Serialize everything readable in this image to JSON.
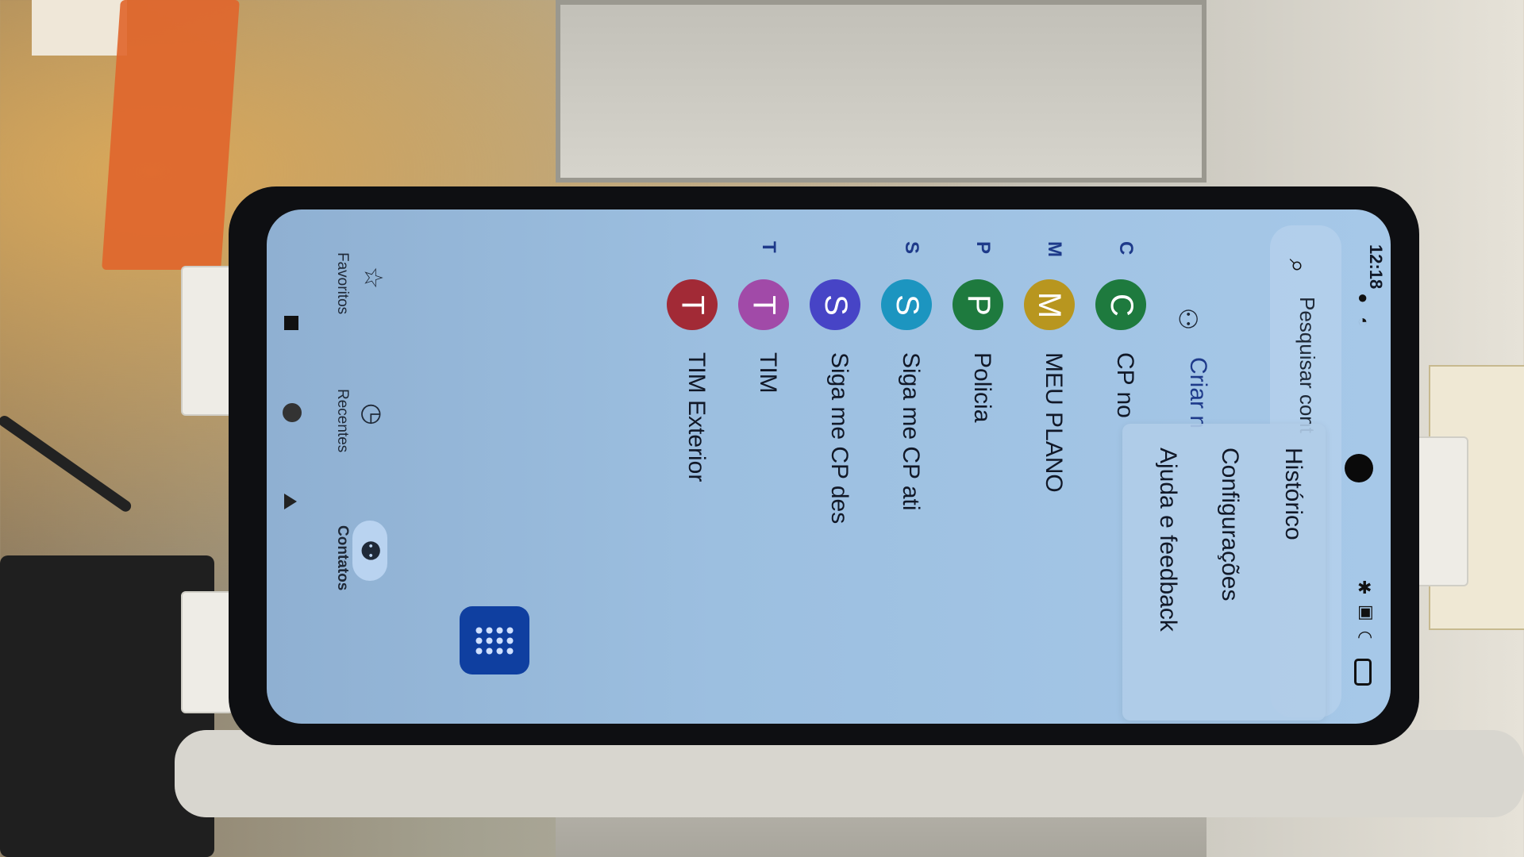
{
  "statusbar": {
    "time": "12:18",
    "icons": [
      "notification-icon",
      "alarm-icon",
      "bluetooth-icon",
      "nfc-icon",
      "wifi-icon",
      "battery-icon"
    ]
  },
  "search": {
    "placeholder": "Pesquisar cont"
  },
  "create_contact": {
    "label": "Criar n"
  },
  "overflow_menu": {
    "items": [
      {
        "label": "Histórico"
      },
      {
        "label": "Configurações"
      },
      {
        "label": "Ajuda e feedback"
      }
    ]
  },
  "contacts": {
    "groups": [
      {
        "letter": "C",
        "entries": [
          {
            "initial": "C",
            "name": "CP no",
            "color": "#1e7a3e"
          }
        ]
      },
      {
        "letter": "M",
        "entries": [
          {
            "initial": "M",
            "name": "MEU PLANO",
            "color": "#b8961f"
          }
        ]
      },
      {
        "letter": "P",
        "entries": [
          {
            "initial": "P",
            "name": "Policia",
            "color": "#1e7a3e"
          }
        ]
      },
      {
        "letter": "S",
        "entries": [
          {
            "initial": "S",
            "name": "Siga me CP ati",
            "color": "#1c95c0"
          },
          {
            "initial": "S",
            "name": "Siga me CP des",
            "color": "#4744c6"
          }
        ]
      },
      {
        "letter": "T",
        "entries": [
          {
            "initial": "T",
            "name": "TIM",
            "color": "#a14aa8"
          },
          {
            "initial": "T",
            "name": "TIM Exterior",
            "color": "#a22a36"
          }
        ]
      }
    ]
  },
  "bottom_nav": {
    "favorites": "Favoritos",
    "recents": "Recentes",
    "contacts": "Contatos"
  },
  "colors": {
    "fab": "#0f3fa0",
    "accent": "#1e3a8a"
  }
}
